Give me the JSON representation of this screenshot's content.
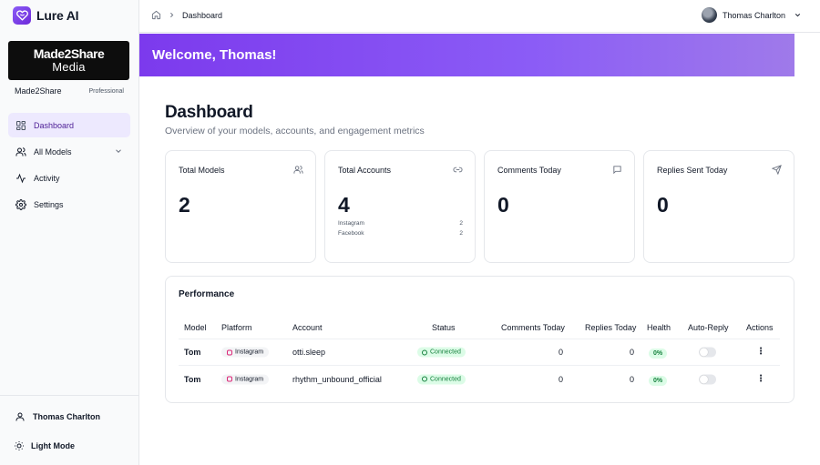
{
  "brand": {
    "name": "Lure AI",
    "icon": "heart-logo-icon",
    "accent": "#7c3aed"
  },
  "org": {
    "banner_line1": "Made2Share",
    "banner_line2": "Media",
    "name": "Made2Share",
    "plan": "Professional"
  },
  "sidebar": {
    "items": [
      {
        "label": "Dashboard",
        "icon": "grid-icon",
        "active": true
      },
      {
        "label": "All Models",
        "icon": "users-icon",
        "expandable": true
      },
      {
        "label": "Activity",
        "icon": "activity-icon"
      },
      {
        "label": "Settings",
        "icon": "gear-icon"
      }
    ],
    "user_name": "Thomas Charlton",
    "theme_label": "Light Mode"
  },
  "header": {
    "breadcrumb": [
      "Dashboard"
    ],
    "user_name": "Thomas Charlton"
  },
  "welcome": {
    "text": "Welcome, Thomas!"
  },
  "page": {
    "title": "Dashboard",
    "subtitle": "Overview of your models, accounts, and engagement metrics"
  },
  "cards": [
    {
      "title": "Total Models",
      "value": "2",
      "icon": "users-icon"
    },
    {
      "title": "Total Accounts",
      "value": "4",
      "icon": "link-icon",
      "breakdown": [
        {
          "label": "Instagram",
          "value": "2"
        },
        {
          "label": "Facebook",
          "value": "2"
        }
      ]
    },
    {
      "title": "Comments Today",
      "value": "0",
      "icon": "message-icon"
    },
    {
      "title": "Replies Sent Today",
      "value": "0",
      "icon": "send-icon"
    }
  ],
  "performance": {
    "title": "Performance",
    "columns": [
      "Model",
      "Platform",
      "Account",
      "Status",
      "Comments Today",
      "Replies Today",
      "Health",
      "Auto-Reply",
      "Actions"
    ],
    "rows": [
      {
        "model": "Tom",
        "platform": "Instagram",
        "account": "otti.sleep",
        "status": "Connected",
        "comments": "0",
        "replies": "0",
        "health": "0%",
        "auto_reply": false
      },
      {
        "model": "Tom",
        "platform": "Instagram",
        "account": "rhythm_unbound_official",
        "status": "Connected",
        "comments": "0",
        "replies": "0",
        "health": "0%",
        "auto_reply": false
      }
    ]
  }
}
